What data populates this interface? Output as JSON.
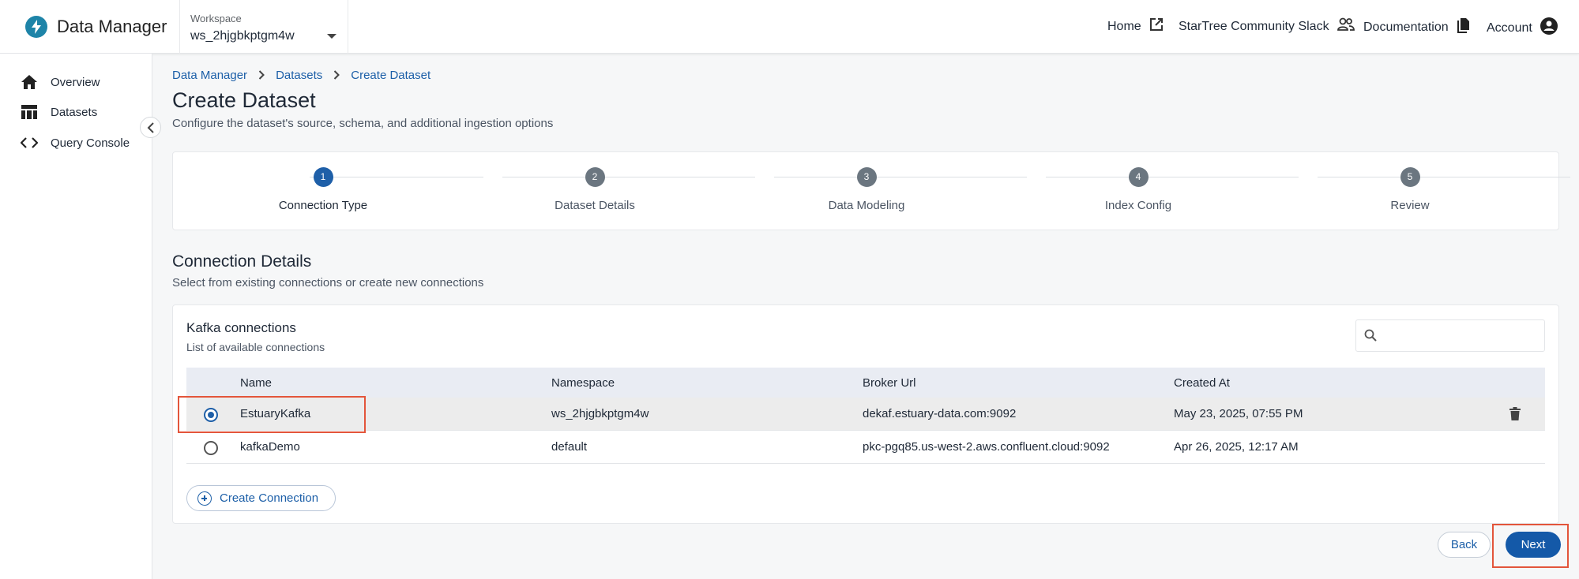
{
  "app": {
    "name": "Data Manager",
    "logo_icon": "bolt-icon",
    "brand_color": "#1e84a8"
  },
  "workspace": {
    "label": "Workspace",
    "value": "ws_2hjgbkptgm4w"
  },
  "topnav": {
    "home": "Home",
    "slack": "StarTree Community Slack",
    "docs": "Documentation",
    "account": "Account"
  },
  "sidebar": {
    "items": [
      {
        "label": "Overview",
        "icon": "home-icon"
      },
      {
        "label": "Datasets",
        "icon": "table-icon"
      },
      {
        "label": "Query Console",
        "icon": "code-icon"
      }
    ]
  },
  "breadcrumb": [
    "Data Manager",
    "Datasets",
    "Create Dataset"
  ],
  "page": {
    "title": "Create Dataset",
    "subtitle": "Configure the dataset's source, schema, and additional ingestion options"
  },
  "steps": [
    {
      "num": "1",
      "label": "Connection Type",
      "active": true
    },
    {
      "num": "2",
      "label": "Dataset Details",
      "active": false
    },
    {
      "num": "3",
      "label": "Data Modeling",
      "active": false
    },
    {
      "num": "4",
      "label": "Index Config",
      "active": false
    },
    {
      "num": "5",
      "label": "Review",
      "active": false
    }
  ],
  "connection_details": {
    "title": "Connection Details",
    "subtitle": "Select from existing connections or create new connections"
  },
  "kafka": {
    "title": "Kafka connections",
    "subtitle": "List of available connections",
    "search_placeholder": "",
    "columns": [
      "Name",
      "Namespace",
      "Broker Url",
      "Created At"
    ],
    "rows": [
      {
        "name": "EstuaryKafka",
        "namespace": "ws_2hjgbkptgm4w",
        "broker": "dekaf.estuary-data.com:9092",
        "created": "May 23, 2025, 07:55 PM",
        "selected": true
      },
      {
        "name": "kafkaDemo",
        "namespace": "default",
        "broker": "pkc-pgq85.us-west-2.aws.confluent.cloud:9092",
        "created": "Apr 26, 2025, 12:17 AM",
        "selected": false
      }
    ],
    "create_label": "Create Connection"
  },
  "actions": {
    "back": "Back",
    "next": "Next"
  },
  "colors": {
    "accent": "#1e5fa8",
    "highlight": "#e3553b"
  }
}
